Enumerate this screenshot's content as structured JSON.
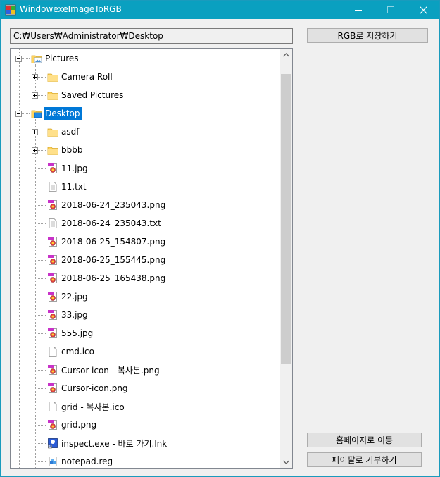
{
  "window": {
    "title": "WindowexeImageToRGB",
    "minimize_glyph": "—",
    "maximize_glyph": "☐",
    "close_glyph": "✕"
  },
  "path": {
    "value": "C:₩Users₩Administrator₩Desktop"
  },
  "buttons": {
    "save": "RGB로 저장하기",
    "home": "홈페이지로 이동",
    "donate": "페이팔로 기부하기"
  },
  "tree": {
    "nodes": [
      {
        "label": "Pictures",
        "icon": "folder-pictures-icon",
        "level": 0,
        "expander": "minus"
      },
      {
        "label": "Camera Roll",
        "icon": "folder-icon",
        "level": 1,
        "expander": "plus"
      },
      {
        "label": "Saved Pictures",
        "icon": "folder-icon",
        "level": 1,
        "expander": "plus"
      },
      {
        "label": "Desktop",
        "icon": "folder-desktop-icon",
        "level": 0,
        "expander": "minus",
        "selected": true
      },
      {
        "label": "asdf",
        "icon": "folder-icon",
        "level": 1,
        "expander": "plus"
      },
      {
        "label": "bbbb",
        "icon": "folder-icon",
        "level": 1,
        "expander": "plus"
      },
      {
        "label": "11.jpg",
        "icon": "image-file-icon",
        "level": 1
      },
      {
        "label": "11.txt",
        "icon": "text-file-icon",
        "level": 1
      },
      {
        "label": "2018-06-24_235043.png",
        "icon": "image-file-icon",
        "level": 1
      },
      {
        "label": "2018-06-24_235043.txt",
        "icon": "text-file-icon",
        "level": 1
      },
      {
        "label": "2018-06-25_154807.png",
        "icon": "image-file-icon",
        "level": 1
      },
      {
        "label": "2018-06-25_155445.png",
        "icon": "image-file-icon",
        "level": 1
      },
      {
        "label": "2018-06-25_165438.png",
        "icon": "image-file-icon",
        "level": 1
      },
      {
        "label": "22.jpg",
        "icon": "image-file-icon",
        "level": 1
      },
      {
        "label": "33.jpg",
        "icon": "image-file-icon",
        "level": 1
      },
      {
        "label": "555.jpg",
        "icon": "image-file-icon",
        "level": 1
      },
      {
        "label": "cmd.ico",
        "icon": "blank-file-icon",
        "level": 1
      },
      {
        "label": "Cursor-icon - 복사본.png",
        "icon": "image-file-icon",
        "level": 1
      },
      {
        "label": "Cursor-icon.png",
        "icon": "image-file-icon",
        "level": 1
      },
      {
        "label": "grid - 복사본.ico",
        "icon": "blank-file-icon",
        "level": 1
      },
      {
        "label": "grid.png",
        "icon": "image-file-icon",
        "level": 1
      },
      {
        "label": "inspect.exe - 바로 가기.lnk",
        "icon": "shortcut-file-icon",
        "level": 1
      },
      {
        "label": "notepad.reg",
        "icon": "registry-file-icon",
        "level": 1
      }
    ]
  },
  "colors": {
    "titlebar": "#0aa0c0",
    "selection": "#0078d7",
    "folder": "#ffd35c"
  }
}
